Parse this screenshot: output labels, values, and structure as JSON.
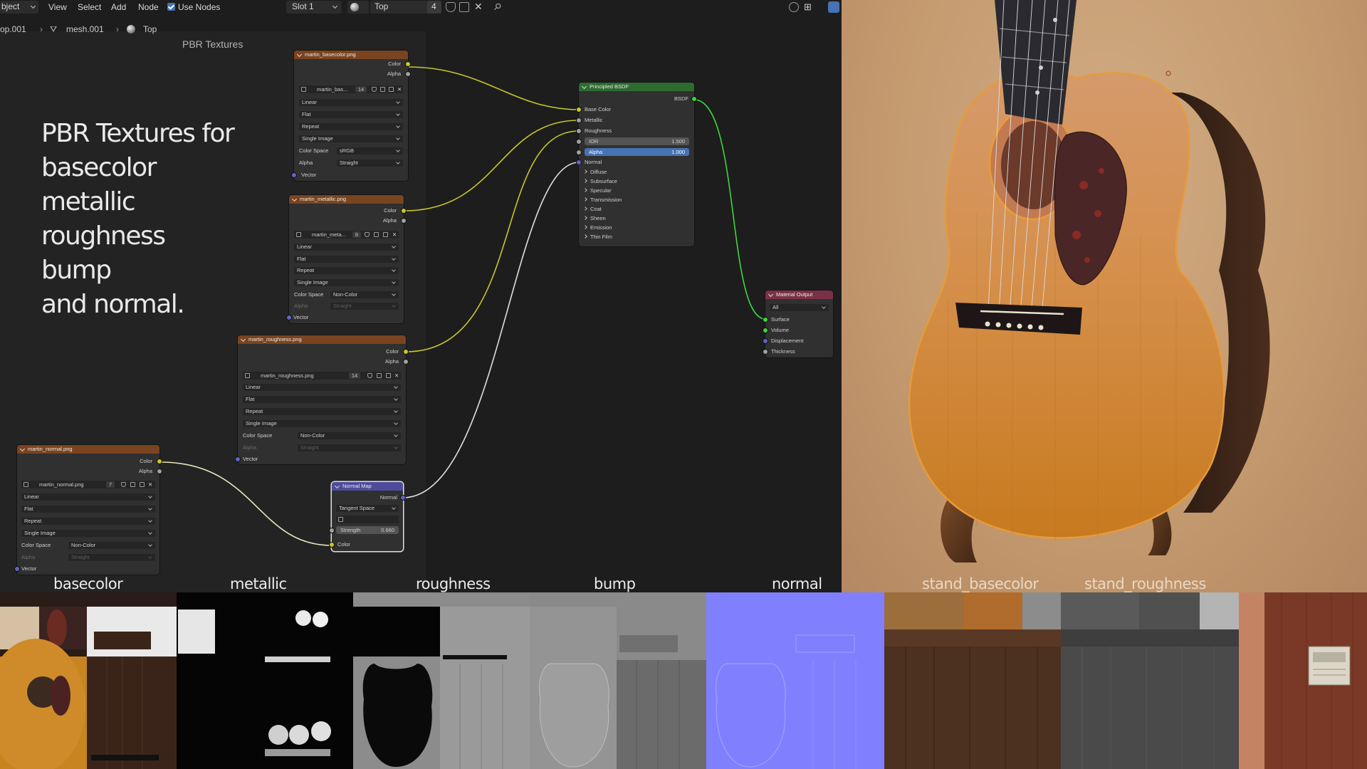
{
  "header": {
    "mode": "bject",
    "menu": [
      "View",
      "Select",
      "Add",
      "Node"
    ],
    "use_nodes_label": "Use Nodes",
    "slot": "Slot 1",
    "material_name": "Top",
    "material_users": "4"
  },
  "breadcrumb": {
    "object": "op.001",
    "mesh": "mesh.001",
    "material": "Top"
  },
  "frame": {
    "label": "PBR Textures"
  },
  "overlay_text": [
    "PBR Textures for",
    "basecolor",
    "metallic",
    "roughness",
    "bump",
    "and normal."
  ],
  "common": {
    "color": "Color",
    "alpha": "Alpha",
    "vector": "Vector",
    "color_space_label": "Color Space",
    "alpha_label": "Alpha",
    "interp": "Linear",
    "proj": "Flat",
    "ext": "Repeat",
    "source": "Single Image",
    "straight": "Straight",
    "srgb": "sRGB",
    "noncolor": "Non-Color"
  },
  "nodes": {
    "basecolor": {
      "title": "martin_basecolor.png",
      "image": "martin_bas...",
      "users": "14"
    },
    "metallic": {
      "title": "martin_metallic.png",
      "image": "martin_meta...",
      "users": "8"
    },
    "roughness": {
      "title": "martin_roughness.png",
      "image": "martin_roughness.png",
      "users": "14"
    },
    "normal": {
      "title": "martin_normal.png",
      "image": "martin_normal.png",
      "users": "7"
    },
    "normal_map": {
      "title": "Normal Map",
      "output": "Normal",
      "space": "Tangent Space",
      "strength_label": "Strength",
      "strength": "0.660",
      "color": "Color"
    },
    "bsdf": {
      "title": "Principled BSDF",
      "output": "BSDF",
      "inputs": [
        "Base Color",
        "Metallic",
        "Roughness"
      ],
      "ior_label": "IOR",
      "ior": "1.500",
      "alpha_label": "Alpha",
      "alpha": "1.000",
      "normal": "Normal",
      "panels": [
        "Diffuse",
        "Subsurface",
        "Specular",
        "Transmission",
        "Coat",
        "Sheen",
        "Emission",
        "Thin Film"
      ]
    },
    "output": {
      "title": "Material Output",
      "target": "All",
      "inputs": [
        "Surface",
        "Volume",
        "Displacement",
        "Thickness"
      ]
    }
  },
  "texture_labels": [
    "basecolor",
    "metallic",
    "roughness",
    "bump",
    "normal",
    "stand_basecolor",
    "stand_roughness"
  ],
  "colors": {
    "texture_header": "#7a4420",
    "shader_header": "#2d6b30",
    "vector_header": "#4e4c9a",
    "output_header": "#7a3146",
    "color_socket": "#c7c729",
    "float_socket": "#a1a1a1",
    "vector_socket": "#6363c7",
    "shader_socket": "#3ed63e",
    "selection_blue": "#4772b3"
  }
}
